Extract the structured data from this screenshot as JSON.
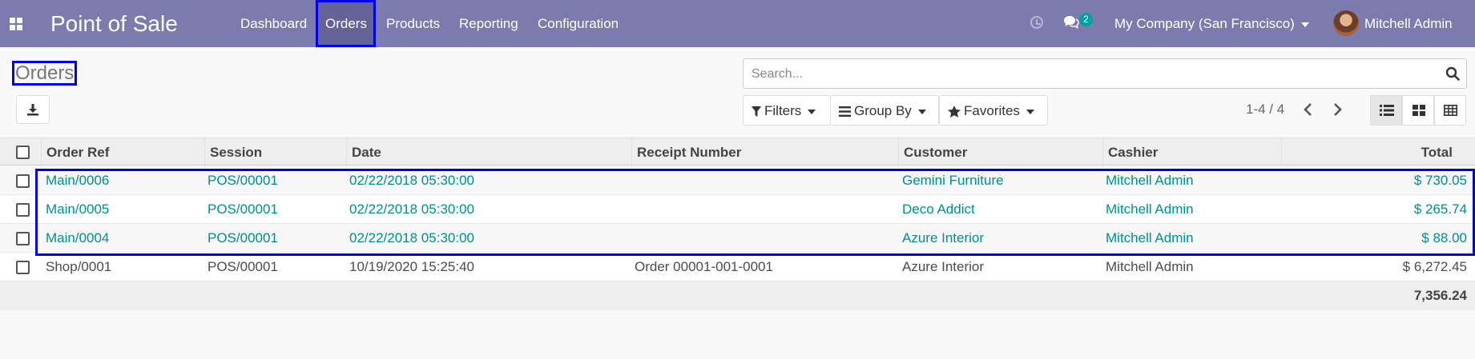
{
  "navbar": {
    "brand": "Point of Sale",
    "menu": [
      {
        "label": "Dashboard"
      },
      {
        "label": "Orders"
      },
      {
        "label": "Products"
      },
      {
        "label": "Reporting"
      },
      {
        "label": "Configuration"
      }
    ],
    "messages_count": "2",
    "company": "My Company (San Francisco)",
    "user": "Mitchell Admin"
  },
  "control_panel": {
    "title": "Orders",
    "search_placeholder": "Search...",
    "filters_label": "Filters",
    "groupby_label": "Group By",
    "favorites_label": "Favorites",
    "pager": "1-4 / 4"
  },
  "table": {
    "columns": [
      "Order Ref",
      "Session",
      "Date",
      "Receipt Number",
      "Customer",
      "Cashier",
      "Total"
    ],
    "rows": [
      {
        "ref": "Main/0006",
        "session": "POS/00001",
        "date": "02/22/2018 05:30:00",
        "receipt": "",
        "customer": "Gemini Furniture",
        "cashier": "Mitchell Admin",
        "total": "$ 730.05"
      },
      {
        "ref": "Main/0005",
        "session": "POS/00001",
        "date": "02/22/2018 05:30:00",
        "receipt": "",
        "customer": "Deco Addict",
        "cashier": "Mitchell Admin",
        "total": "$ 265.74"
      },
      {
        "ref": "Main/0004",
        "session": "POS/00001",
        "date": "02/22/2018 05:30:00",
        "receipt": "",
        "customer": "Azure Interior",
        "cashier": "Mitchell Admin",
        "total": "$ 88.00"
      },
      {
        "ref": "Shop/0001",
        "session": "POS/00001",
        "date": "10/19/2020 15:25:40",
        "receipt": "Order 00001-001-0001",
        "customer": "Azure Interior",
        "cashier": "Mitchell Admin",
        "total": "$ 6,272.45"
      }
    ],
    "footer_total": "7,356.24"
  },
  "colors": {
    "navbar": "#7c7bad",
    "active_menu": "#646397",
    "link": "#008f8c",
    "highlight": "#0000ee"
  }
}
